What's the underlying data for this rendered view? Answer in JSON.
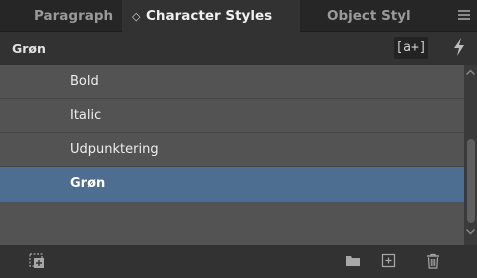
{
  "tabs": [
    {
      "label": "Paragraph",
      "active": false
    },
    {
      "label": "Character Styles",
      "active": true,
      "arrow": "◇"
    },
    {
      "label": "Object Styl",
      "active": false
    }
  ],
  "header": {
    "current_style": "Grøn",
    "new_style_label": "[a+]"
  },
  "styles": [
    {
      "name": "Bold",
      "selected": false
    },
    {
      "name": "Italic",
      "selected": false
    },
    {
      "name": "Udpunktering",
      "selected": false
    },
    {
      "name": "Grøn",
      "selected": true
    }
  ],
  "icons": {
    "menu": "hamburger-icon",
    "lightning": "lightning-icon",
    "load": "load-styles-icon",
    "folder": "folder-icon",
    "new": "plus-icon",
    "delete": "trash-icon"
  },
  "colors": {
    "selection": "#4d6e91",
    "list_bg": "#535353",
    "panel_bg": "#323232",
    "tab_bg": "#262626"
  }
}
